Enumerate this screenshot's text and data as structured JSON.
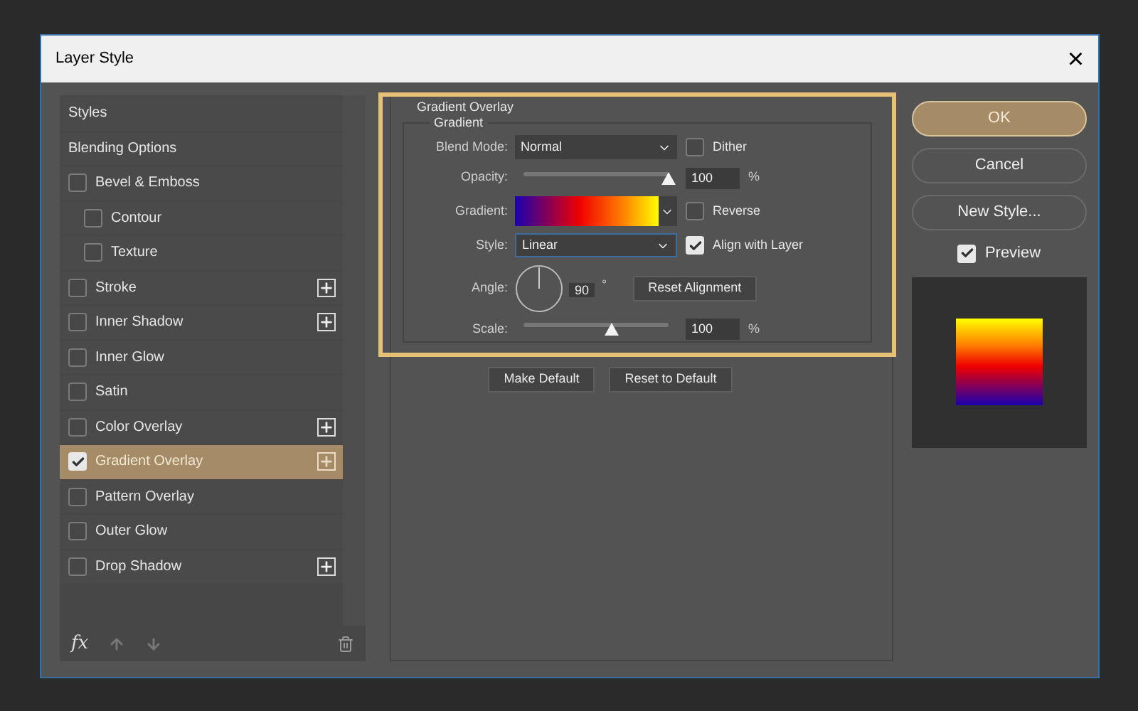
{
  "window": {
    "title": "Layer Style",
    "close": "×"
  },
  "styles": [
    {
      "kind": "header",
      "label": "Styles",
      "selected": false
    },
    {
      "kind": "header",
      "label": "Blending Options",
      "selected": false
    },
    {
      "kind": "effect",
      "label": "Bevel & Emboss",
      "checked": false,
      "selected": false,
      "plus": false,
      "children": [
        {
          "kind": "effect",
          "label": "Contour",
          "checked": false,
          "selected": false,
          "plus": false
        },
        {
          "kind": "effect",
          "label": "Texture",
          "checked": false,
          "selected": false,
          "plus": false
        }
      ]
    },
    {
      "kind": "effect",
      "label": "Stroke",
      "checked": false,
      "selected": false,
      "plus": true
    },
    {
      "kind": "effect",
      "label": "Inner Shadow",
      "checked": false,
      "selected": false,
      "plus": true
    },
    {
      "kind": "effect",
      "label": "Inner Glow",
      "checked": false,
      "selected": false,
      "plus": false
    },
    {
      "kind": "effect",
      "label": "Satin",
      "checked": false,
      "selected": false,
      "plus": false
    },
    {
      "kind": "effect",
      "label": "Color Overlay",
      "checked": false,
      "selected": false,
      "plus": true
    },
    {
      "kind": "effect",
      "label": "Gradient Overlay",
      "checked": true,
      "selected": true,
      "plus": true
    },
    {
      "kind": "effect",
      "label": "Pattern Overlay",
      "checked": false,
      "selected": false,
      "plus": false
    },
    {
      "kind": "effect",
      "label": "Outer Glow",
      "checked": false,
      "selected": false,
      "plus": false
    },
    {
      "kind": "effect",
      "label": "Drop Shadow",
      "checked": false,
      "selected": false,
      "plus": true
    }
  ],
  "toolbar": {
    "fx": "fx"
  },
  "panel": {
    "title": "Gradient Overlay",
    "group": "Gradient",
    "blend_mode": {
      "label": "Blend Mode:",
      "value": "Normal"
    },
    "dither": {
      "label": "Dither",
      "checked": false
    },
    "opacity": {
      "label": "Opacity:",
      "level": 1,
      "value": "100",
      "unit": "%"
    },
    "gradient": {
      "label": "Gradient:"
    },
    "reverse": {
      "label": "Reverse",
      "checked": false
    },
    "style": {
      "label": "Style:",
      "value": "Linear"
    },
    "align": {
      "label": "Align with Layer",
      "checked": true
    },
    "angle": {
      "label": "Angle:",
      "value": "90",
      "unit": "°"
    },
    "reset_alignment": "Reset Alignment",
    "scale": {
      "label": "Scale:",
      "level": 0.61,
      "value": "100",
      "unit": "%"
    },
    "buttons": [
      "Make Default",
      "Reset to Default"
    ]
  },
  "actions": [
    {
      "label": "OK",
      "primary": true
    },
    {
      "label": "Cancel",
      "primary": false
    },
    {
      "label": "New Style...",
      "primary": false
    }
  ],
  "preview": {
    "label": "Preview",
    "checked": true
  }
}
